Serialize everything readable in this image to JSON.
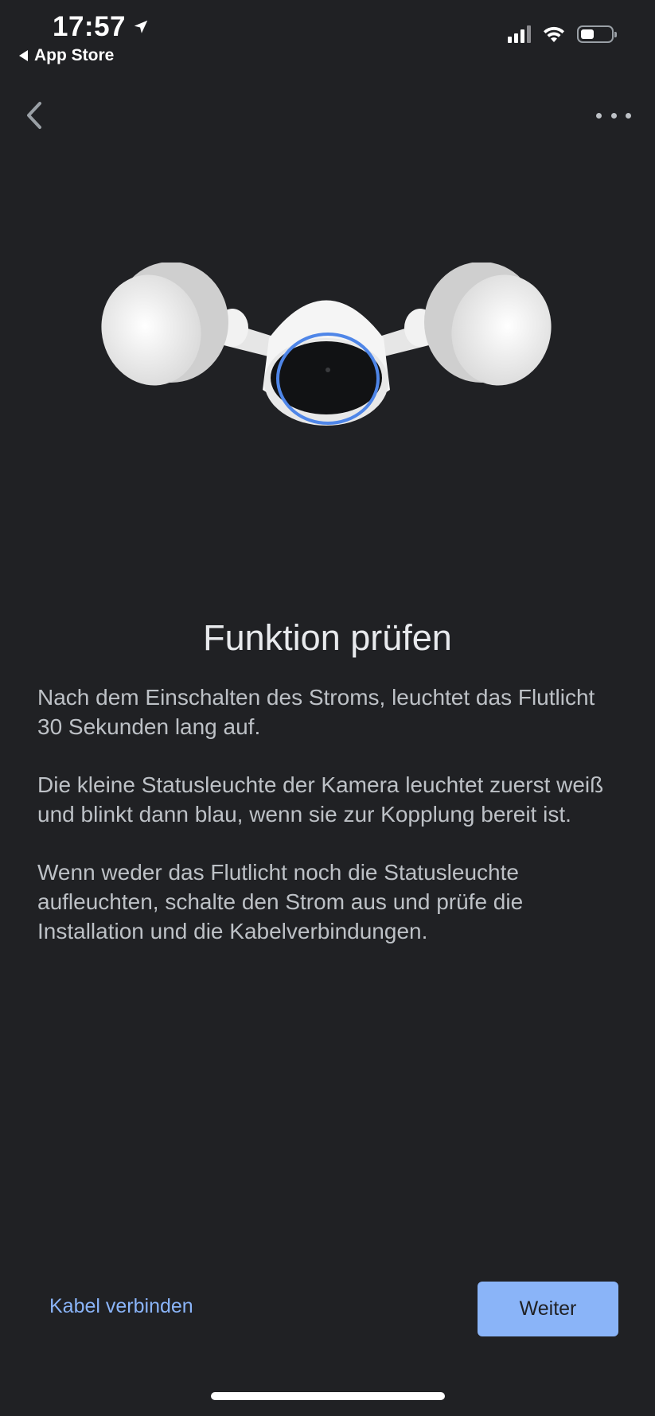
{
  "status_bar": {
    "time": "17:57",
    "back_app_label": "App Store",
    "icons": [
      "location-arrow-icon",
      "cellular-signal-icon",
      "wifi-icon",
      "battery-icon"
    ]
  },
  "nav": {
    "back_icon": "chevron-left-icon",
    "more_icon": "more-horizontal-icon"
  },
  "hero": {
    "illustration": "floodlight-camera-illustration",
    "ring_color": "#4f86e8"
  },
  "main": {
    "title": "Funktion prüfen",
    "paragraphs": [
      "Nach dem Einschalten des Stroms, leuchtet das Flutlicht 30 Sekunden lang auf.",
      "Die kleine Statusleuchte der Kamera leuchtet zuerst weiß und blinkt dann blau, wenn sie zur Kopplung bereit ist.",
      "Wenn weder das Flutlicht noch die Statusleuchte aufleuchten, schalte den Strom aus und prüfe die Installation und die Kabelverbindungen."
    ]
  },
  "footer": {
    "secondary_label": "Kabel verbinden",
    "primary_label": "Weiter"
  },
  "colors": {
    "background": "#202124",
    "accent": "#8ab4f8",
    "text_primary": "#e8eaed",
    "text_secondary": "#bdc1c6"
  }
}
